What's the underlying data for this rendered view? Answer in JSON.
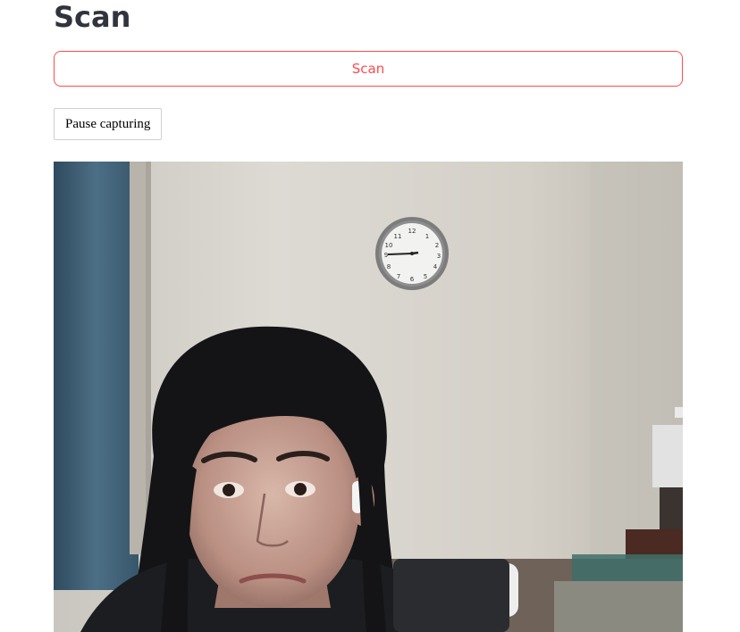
{
  "page": {
    "title": "Scan"
  },
  "controls": {
    "scan_label": "Scan",
    "pause_label": "Pause capturing"
  },
  "video_feed": {
    "description_icon": "webcam-feed",
    "accent_color": "#ff4b4b"
  }
}
